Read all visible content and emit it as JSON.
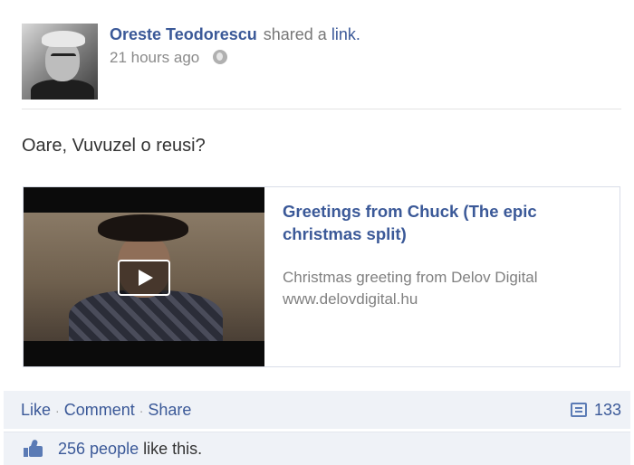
{
  "post": {
    "author": "Oreste Teodorescu",
    "action_prefix": "shared a",
    "action_link": "link.",
    "time": "21 hours ago",
    "privacy_icon": "globe-icon",
    "text": "Oare, Vuvuzel o reusi?"
  },
  "attachment": {
    "title": "Greetings from Chuck (The epic christmas split)",
    "description": "Christmas greeting from Delov Digital",
    "url": "www.delovdigital.hu",
    "media_icon": "play-icon"
  },
  "actions": {
    "like": "Like",
    "comment": "Comment",
    "share": "Share",
    "separator": "·",
    "share_count": "133",
    "share_icon": "share-count-icon"
  },
  "likes": {
    "icon": "thumbs-up-icon",
    "people": "256 people",
    "suffix": "like this."
  },
  "colors": {
    "link": "#3b5998",
    "action_bar_bg": "#eff2f7",
    "meta_text": "#8a8a8a"
  }
}
